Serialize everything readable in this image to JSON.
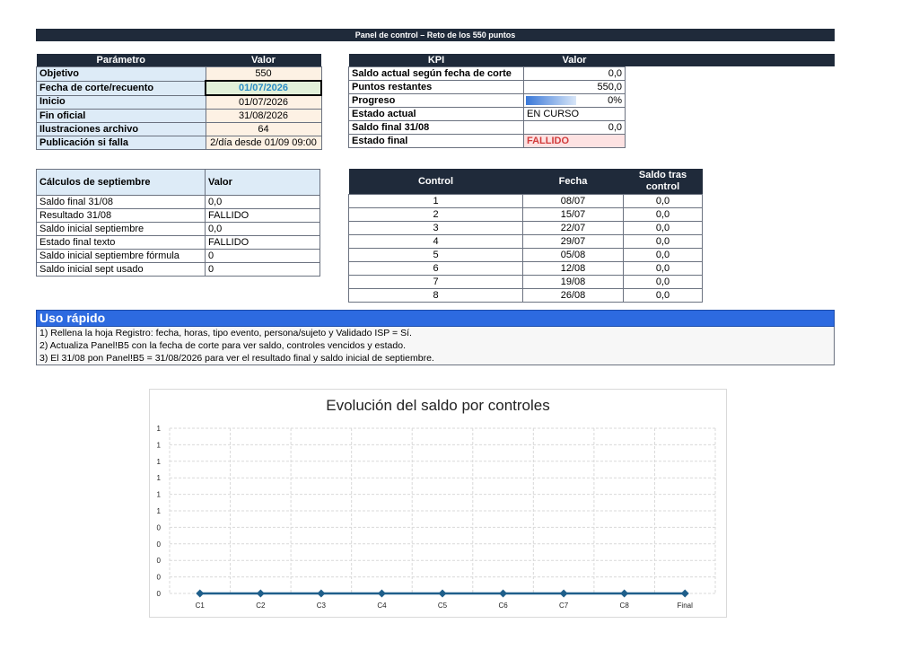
{
  "title_bar": "Panel de control – Reto de los 550 puntos",
  "param_table": {
    "headers": [
      "Parámetro",
      "Valor"
    ],
    "rows": [
      {
        "name": "Objetivo",
        "value": "550"
      },
      {
        "name": "Fecha de corte/recuento",
        "value": "01/07/2026"
      },
      {
        "name": "Inicio",
        "value": "01/07/2026"
      },
      {
        "name": "Fin oficial",
        "value": "31/08/2026"
      },
      {
        "name": "Ilustraciones archivo",
        "value": "64"
      },
      {
        "name": "Publicación si falla",
        "value": "2/día desde 01/09 09:00"
      }
    ]
  },
  "kpi_table": {
    "headers": [
      "KPI",
      "Valor"
    ],
    "rows": [
      {
        "name": "Saldo actual según fecha de corte",
        "value": "0,0"
      },
      {
        "name": "Puntos restantes",
        "value": "550,0"
      },
      {
        "name": "Progreso",
        "value": "0%"
      },
      {
        "name": "Estado actual",
        "value": "EN CURSO"
      },
      {
        "name": "Saldo final 31/08",
        "value": "0,0"
      },
      {
        "name": "Estado final",
        "value": "FALLIDO"
      }
    ]
  },
  "sept_table": {
    "headers": [
      "Cálculos de septiembre",
      "Valor"
    ],
    "rows": [
      {
        "name": "Saldo final 31/08",
        "value": "0,0"
      },
      {
        "name": "Resultado 31/08",
        "value": "FALLIDO"
      },
      {
        "name": "Saldo inicial septiembre",
        "value": "0,0"
      },
      {
        "name": "Estado final texto",
        "value": "FALLIDO"
      },
      {
        "name": "Saldo inicial septiembre fórmula",
        "value": "0"
      },
      {
        "name": "Saldo inicial sept usado",
        "value": "0"
      }
    ]
  },
  "control_table": {
    "headers": [
      "Control",
      "Fecha",
      "Saldo tras control"
    ],
    "rows": [
      {
        "control": "1",
        "fecha": "08/07",
        "saldo": "0,0"
      },
      {
        "control": "2",
        "fecha": "15/07",
        "saldo": "0,0"
      },
      {
        "control": "3",
        "fecha": "22/07",
        "saldo": "0,0"
      },
      {
        "control": "4",
        "fecha": "29/07",
        "saldo": "0,0"
      },
      {
        "control": "5",
        "fecha": "05/08",
        "saldo": "0,0"
      },
      {
        "control": "6",
        "fecha": "12/08",
        "saldo": "0,0"
      },
      {
        "control": "7",
        "fecha": "19/08",
        "saldo": "0,0"
      },
      {
        "control": "8",
        "fecha": "26/08",
        "saldo": "0,0"
      }
    ]
  },
  "quick_use": {
    "title": "Uso rápido",
    "lines": [
      "1) Rellena la hoja Registro: fecha, horas, tipo evento, persona/sujeto y Validado ISP = Sí.",
      "2) Actualiza Panel!B5 con la fecha de corte para ver saldo, controles vencidos y estado.",
      "3) El 31/08 pon Panel!B5 = 31/08/2026 para ver el resultado final y saldo inicial de septiembre."
    ]
  },
  "colors": {
    "dark_header": "#1f2a3a",
    "light_blue": "#ddebf7",
    "accent_blue": "#2d6ae0",
    "fail_red": "#d23b3b",
    "line_color": "#1f5f8b"
  },
  "chart_data": {
    "type": "line",
    "title": "Evolución del saldo por controles",
    "categories": [
      "C1",
      "C2",
      "C3",
      "C4",
      "C5",
      "C6",
      "C7",
      "C8",
      "Final"
    ],
    "series": [
      {
        "values": [
          0,
          0,
          0,
          0,
          0,
          0,
          0,
          0,
          0
        ]
      }
    ],
    "ytick_labels": [
      "0",
      "0",
      "0",
      "0",
      "0",
      "1",
      "1",
      "1",
      "1",
      "1",
      "1"
    ],
    "ylim": [
      0,
      1
    ],
    "grid": true,
    "xlabel": "",
    "ylabel": ""
  }
}
